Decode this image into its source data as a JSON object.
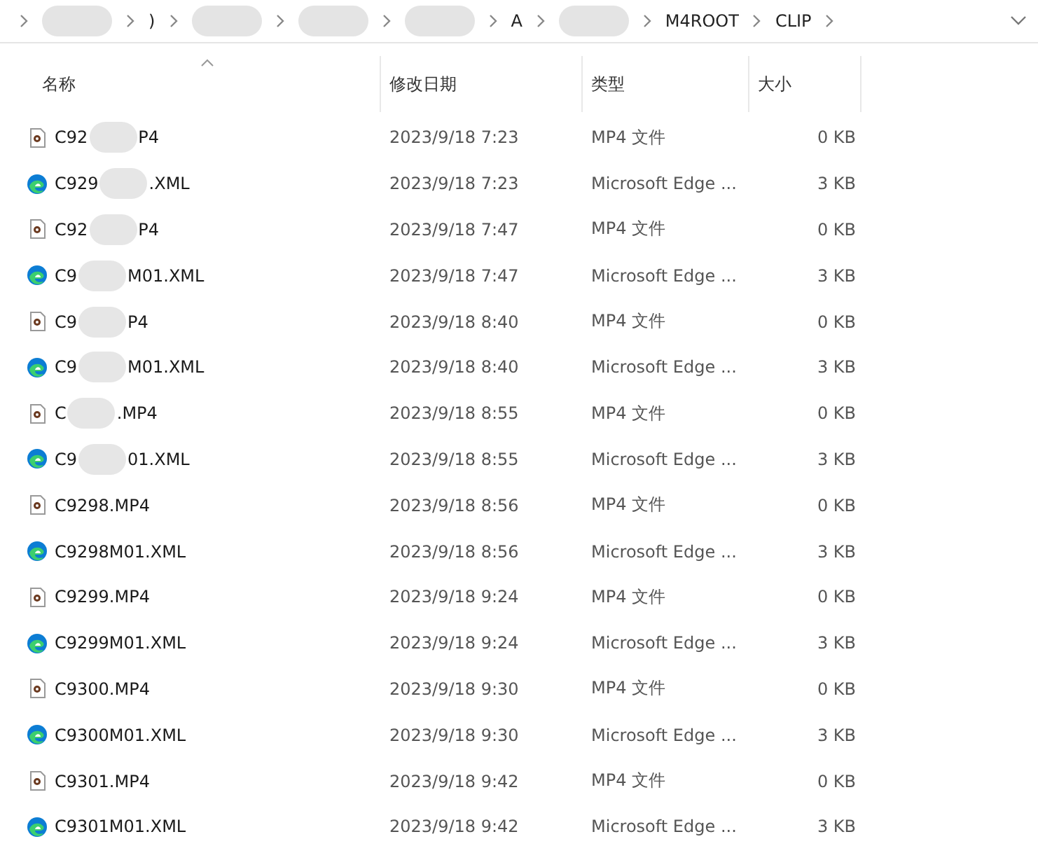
{
  "breadcrumb": [
    {
      "kind": "hidden"
    },
    {
      "kind": "text",
      "label": ")"
    },
    {
      "kind": "hidden"
    },
    {
      "kind": "hidden"
    },
    {
      "kind": "hidden"
    },
    {
      "kind": "text",
      "label": "A"
    },
    {
      "kind": "hidden"
    },
    {
      "kind": "text",
      "label": "M4ROOT"
    },
    {
      "kind": "text",
      "label": "CLIP"
    }
  ],
  "columns": [
    {
      "label": "名称",
      "sorted": true
    },
    {
      "label": "修改日期",
      "sorted": false
    },
    {
      "label": "类型",
      "sorted": false
    },
    {
      "label": "大小",
      "sorted": false
    }
  ],
  "rows": [
    {
      "kind": "video",
      "name": [
        "C92",
        "P4"
      ],
      "date": "2023/9/18 7:23",
      "type": "MP4 文件",
      "size": "0 KB"
    },
    {
      "kind": "edge",
      "name": [
        "C929",
        ".XML"
      ],
      "date": "2023/9/18 7:23",
      "type": "Microsoft Edge ...",
      "size": "3 KB"
    },
    {
      "kind": "video",
      "name": [
        "C92",
        "P4"
      ],
      "date": "2023/9/18 7:47",
      "type": "MP4 文件",
      "size": "0 KB"
    },
    {
      "kind": "edge",
      "name": [
        "C9",
        "M01.XML"
      ],
      "date": "2023/9/18 7:47",
      "type": "Microsoft Edge ...",
      "size": "3 KB"
    },
    {
      "kind": "video",
      "name": [
        "C9",
        "P4"
      ],
      "date": "2023/9/18 8:40",
      "type": "MP4 文件",
      "size": "0 KB"
    },
    {
      "kind": "edge",
      "name": [
        "C9",
        "M01.XML"
      ],
      "date": "2023/9/18 8:40",
      "type": "Microsoft Edge ...",
      "size": "3 KB"
    },
    {
      "kind": "video",
      "name": [
        "C",
        ".MP4"
      ],
      "date": "2023/9/18 8:55",
      "type": "MP4 文件",
      "size": "0 KB"
    },
    {
      "kind": "edge",
      "name": [
        "C9",
        "01.XML"
      ],
      "date": "2023/9/18 8:55",
      "type": "Microsoft Edge ...",
      "size": "3 KB"
    },
    {
      "kind": "video",
      "name": [
        "C9298.MP4"
      ],
      "date": "2023/9/18 8:56",
      "type": "MP4 文件",
      "size": "0 KB"
    },
    {
      "kind": "edge",
      "name": [
        "C9298M01.XML"
      ],
      "date": "2023/9/18 8:56",
      "type": "Microsoft Edge ...",
      "size": "3 KB"
    },
    {
      "kind": "video",
      "name": [
        "C9299.MP4"
      ],
      "date": "2023/9/18 9:24",
      "type": "MP4 文件",
      "size": "0 KB"
    },
    {
      "kind": "edge",
      "name": [
        "C9299M01.XML"
      ],
      "date": "2023/9/18 9:24",
      "type": "Microsoft Edge ...",
      "size": "3 KB"
    },
    {
      "kind": "video",
      "name": [
        "C9300.MP4"
      ],
      "date": "2023/9/18 9:30",
      "type": "MP4 文件",
      "size": "0 KB"
    },
    {
      "kind": "edge",
      "name": [
        "C9300M01.XML"
      ],
      "date": "2023/9/18 9:30",
      "type": "Microsoft Edge ...",
      "size": "3 KB"
    },
    {
      "kind": "video",
      "name": [
        "C9301.MP4"
      ],
      "date": "2023/9/18 9:42",
      "type": "MP4 文件",
      "size": "0 KB"
    },
    {
      "kind": "edge",
      "name": [
        "C9301M01.XML"
      ],
      "date": "2023/9/18 9:42",
      "type": "Microsoft Edge ...",
      "size": "3 KB"
    }
  ]
}
